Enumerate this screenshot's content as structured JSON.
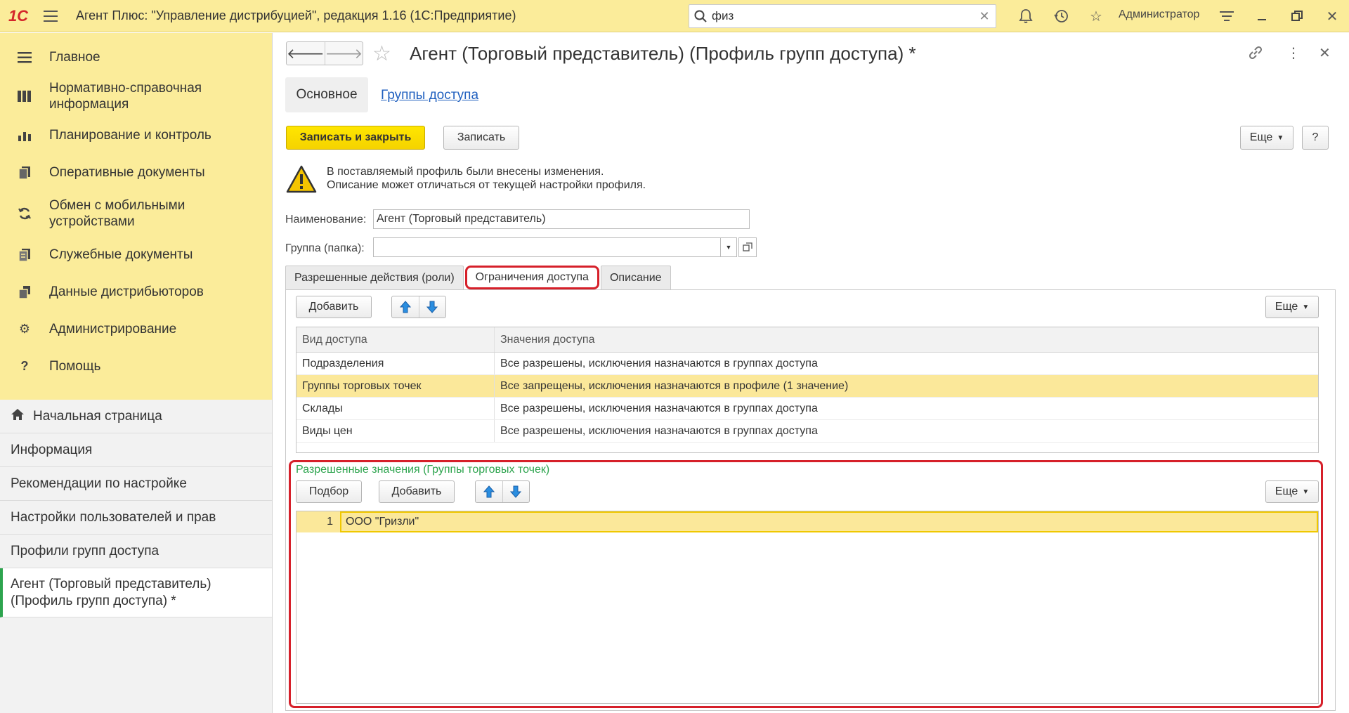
{
  "titlebar": {
    "logo": "1С",
    "title": "Агент Плюс: \"Управление дистрибуцией\", редакция 1.16  (1С:Предприятие)",
    "search_value": "физ",
    "user": "Администратор"
  },
  "sidebar": {
    "menu": [
      {
        "label": "Главное",
        "icon": "list-icon"
      },
      {
        "label": "Нормативно-справочная информация",
        "icon": "catalog-icon"
      },
      {
        "label": "Планирование и контроль",
        "icon": "bar-chart-icon"
      },
      {
        "label": "Оперативные документы",
        "icon": "documents-icon"
      },
      {
        "label": "Обмен с мобильными устройствами",
        "icon": "sync-icon"
      },
      {
        "label": "Служебные документы",
        "icon": "service-docs-icon"
      },
      {
        "label": "Данные дистрибьюторов",
        "icon": "distributor-data-icon"
      },
      {
        "label": "Администрирование",
        "icon": "gear-icon"
      },
      {
        "label": "Помощь",
        "icon": "help-icon"
      }
    ],
    "nav": [
      {
        "label": "Начальная страница"
      },
      {
        "label": "Информация"
      },
      {
        "label": "Рекомендации по настройке"
      },
      {
        "label": "Настройки пользователей и прав"
      },
      {
        "label": "Профили групп доступа"
      },
      {
        "label": "Агент (Торговый представитель) (Профиль групп доступа) *"
      }
    ]
  },
  "form": {
    "title": "Агент (Торговый представитель) (Профиль групп доступа) *",
    "tab_main": "Основное",
    "tab_link": "Группы доступа",
    "btn_save_close": "Записать и закрыть",
    "btn_save": "Записать",
    "btn_more": "Еще",
    "btn_help": "?",
    "warning_line1": "В поставляемый профиль были внесены изменения.",
    "warning_line2": "Описание может отличаться от текущей настройки профиля.",
    "name_label": "Наименование:",
    "name_value": "Агент (Торговый представитель)",
    "group_label": "Группа (папка):",
    "group_value": ""
  },
  "tabs": [
    {
      "label": "Разрешенные действия (роли)"
    },
    {
      "label": "Ограничения доступа"
    },
    {
      "label": "Описание"
    }
  ],
  "access": {
    "btn_add": "Добавить",
    "btn_more": "Еще",
    "headers": [
      "Вид доступа",
      "Значения доступа"
    ],
    "rows": [
      {
        "kind": "Подразделения",
        "value": "Все разрешены, исключения назначаются в группах доступа"
      },
      {
        "kind": "Группы торговых точек",
        "value": "Все запрещены, исключения назначаются в профиле (1 значение)"
      },
      {
        "kind": "Склады",
        "value": "Все разрешены, исключения назначаются в группах доступа"
      },
      {
        "kind": "Виды цен",
        "value": "Все разрешены, исключения назначаются в группах доступа"
      }
    ]
  },
  "allowed": {
    "title": "Разрешенные значения (Группы торговых точек)",
    "btn_pick": "Подбор",
    "btn_add": "Добавить",
    "btn_more": "Еще",
    "rows": [
      {
        "num": "1",
        "value": "ООО \"Гризли\""
      }
    ]
  },
  "colors": {
    "accent_yellow": "#fbec9a",
    "highlight_red": "#d6202a",
    "section_green": "#2da44e",
    "link_blue": "#1f5fbf"
  }
}
